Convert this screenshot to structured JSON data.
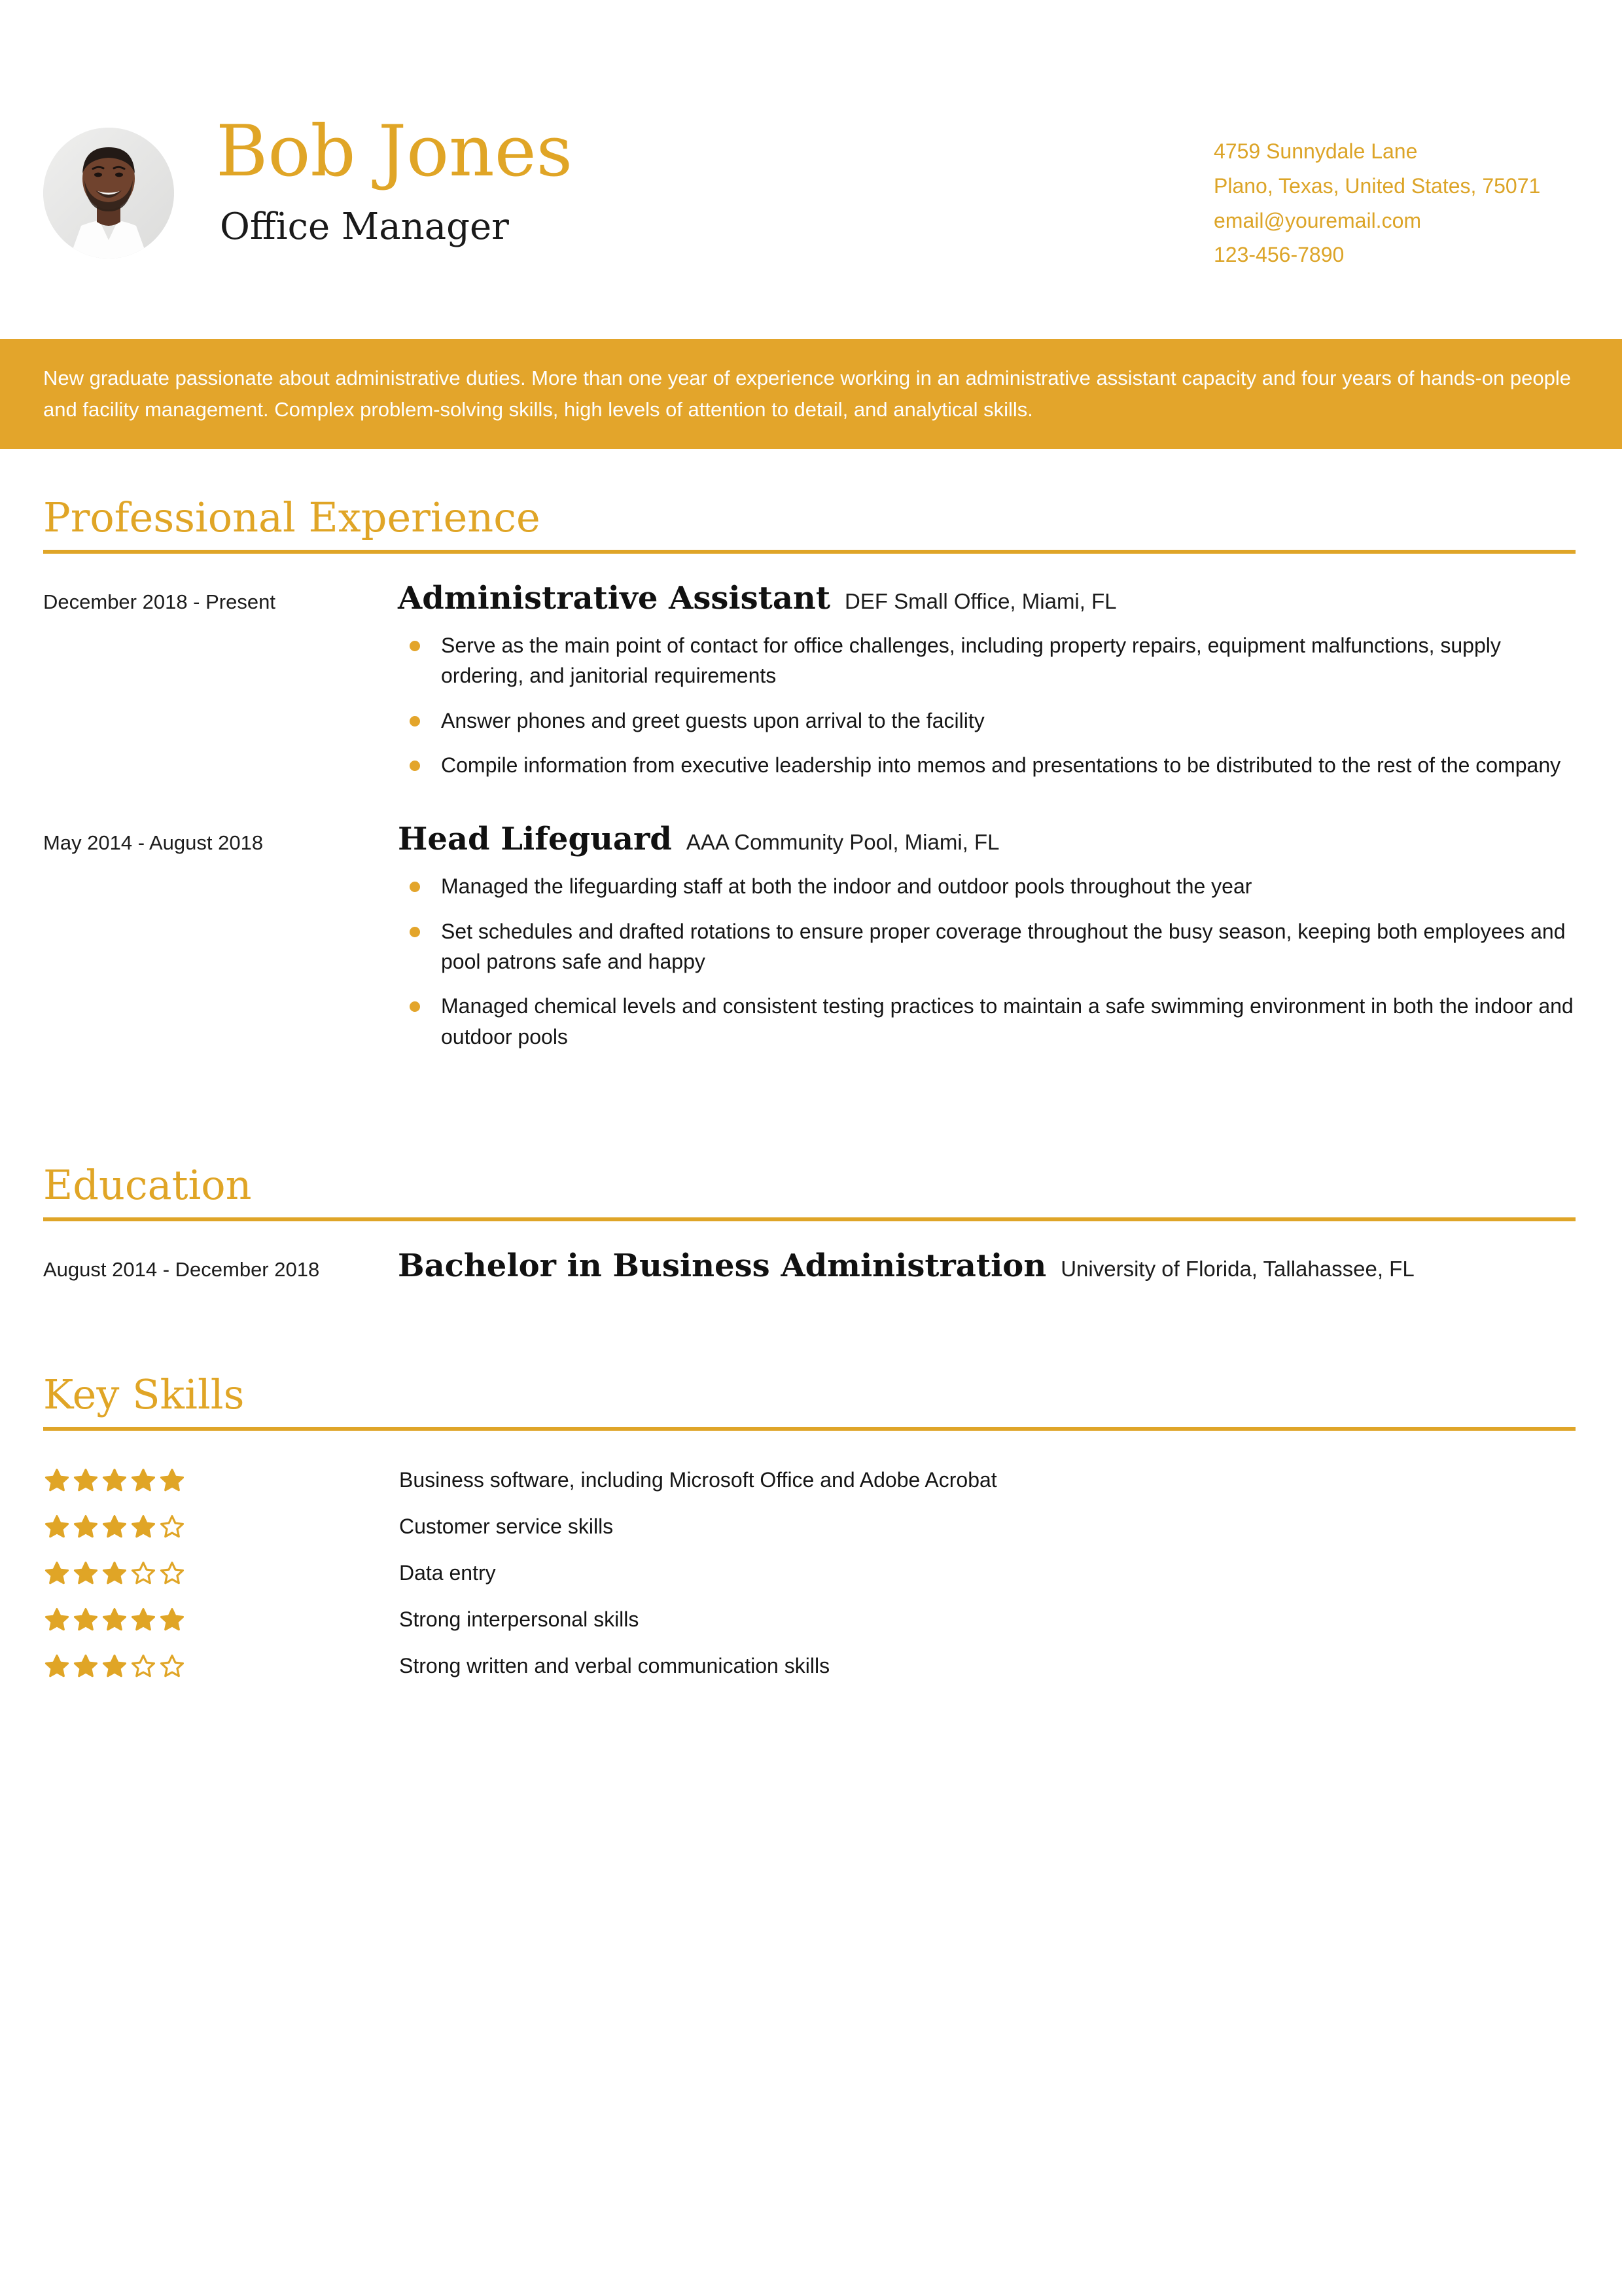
{
  "colors": {
    "accent": "#e0a526",
    "banner": "#e3a52b",
    "rule": "#dfa528",
    "text": "#151515",
    "banner_text": "#ffffff"
  },
  "header": {
    "full_name": "Bob Jones",
    "job_title": "Office Manager",
    "photo_alt": "portrait-photo",
    "contact": {
      "address_line1": "4759 Sunnydale Lane",
      "address_line2": "Plano, Texas, United States, 75071",
      "email": "email@youremail.com",
      "phone": "123-456-7890"
    }
  },
  "summary": {
    "text": "New graduate passionate about administrative duties. More than one year of experience working in an administrative assistant capacity and four years of hands-on people and facility management. Complex problem-solving skills, high levels of attention to detail, and analytical skills."
  },
  "sections": {
    "experience": {
      "title": "Professional Experience",
      "entries": [
        {
          "date": "December 2018 - Present",
          "role": "Administrative Assistant",
          "org": "DEF Small Office, Miami, FL",
          "bullets": [
            "Serve as the main point of contact for office challenges, including property repairs, equipment malfunctions, supply ordering, and janitorial requirements",
            "Answer phones and greet guests upon arrival to the facility",
            "Compile information from executive leadership into memos and presentations to be distributed to the rest of the company"
          ]
        },
        {
          "date": "May 2014 - August 2018",
          "role": "Head Lifeguard",
          "org": "AAA Community Pool, Miami, FL",
          "bullets": [
            "Managed the lifeguarding staff at both the indoor and outdoor pools throughout the year",
            "Set schedules and drafted rotations to ensure proper coverage throughout the busy season, keeping both employees and pool patrons safe and happy",
            "Managed chemical levels and consistent testing practices to maintain a safe swimming environment in both the indoor and outdoor pools"
          ]
        }
      ]
    },
    "education": {
      "title": "Education",
      "entries": [
        {
          "date": "August 2014 - December 2018",
          "role": "Bachelor in Business Administration",
          "org": "University of Florida, Tallahassee, FL",
          "bullets": []
        }
      ]
    },
    "skills": {
      "title": "Key Skills",
      "max_rating": 5,
      "items": [
        {
          "label": "Business software, including Microsoft Office and Adobe Acrobat",
          "rating": 5
        },
        {
          "label": "Customer service skills",
          "rating": 4
        },
        {
          "label": "Data entry",
          "rating": 3
        },
        {
          "label": "Strong interpersonal skills",
          "rating": 5
        },
        {
          "label": "Strong written and verbal communication skills",
          "rating": 3
        }
      ]
    }
  }
}
